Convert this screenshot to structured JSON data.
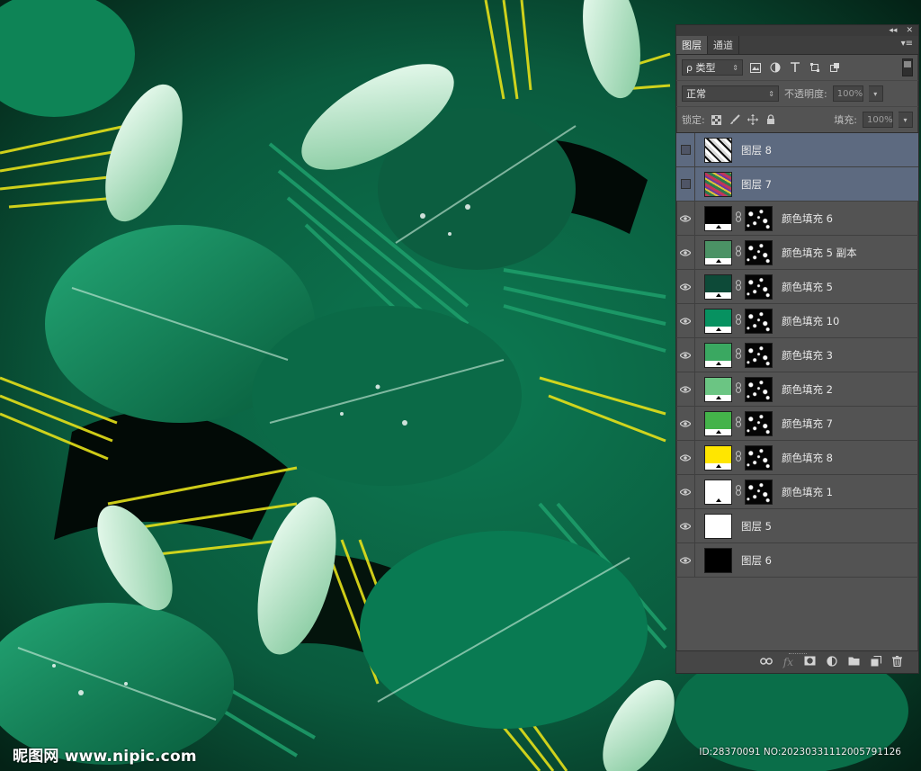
{
  "panel": {
    "tabs": [
      {
        "label": "图层"
      },
      {
        "label": "通道"
      }
    ],
    "topbar": {
      "collapse": "◂◂",
      "close": "✕"
    },
    "menu_glyph": "▾≡",
    "filter": {
      "label": "ρ 类型",
      "arrow": "⇕"
    },
    "blend": {
      "value": "正常",
      "arrow": "⇕",
      "opacity_label": "不透明度:",
      "opacity_value": "100%",
      "opacity_arrow": "▾"
    },
    "lock": {
      "label": "锁定:",
      "fill_label": "填充:",
      "fill_value": "100%",
      "fill_arrow": "▾"
    },
    "layers": [
      {
        "name": "图层 8",
        "visible": false,
        "selected": true,
        "type": "image",
        "thumb_color": "#e9e9e9"
      },
      {
        "name": "图层 7",
        "visible": false,
        "selected": true,
        "type": "image",
        "thumb_color": "#b03a55"
      },
      {
        "name": "颜色填充 6",
        "visible": true,
        "selected": false,
        "type": "fill",
        "thumb_color": "#000000"
      },
      {
        "name": "颜色填充 5 副本",
        "visible": true,
        "selected": false,
        "type": "fill",
        "thumb_color": "#4b9265"
      },
      {
        "name": "颜色填充 5",
        "visible": true,
        "selected": false,
        "type": "fill",
        "thumb_color": "#0d4a38"
      },
      {
        "name": "颜色填充 10",
        "visible": true,
        "selected": false,
        "type": "fill",
        "thumb_color": "#079160"
      },
      {
        "name": "颜色填充 3",
        "visible": true,
        "selected": false,
        "type": "fill",
        "thumb_color": "#3aa861"
      },
      {
        "name": "颜色填充 2",
        "visible": true,
        "selected": false,
        "type": "fill",
        "thumb_color": "#6bc583"
      },
      {
        "name": "颜色填充 7",
        "visible": true,
        "selected": false,
        "type": "fill",
        "thumb_color": "#44b34a"
      },
      {
        "name": "颜色填充 8",
        "visible": true,
        "selected": false,
        "type": "fill",
        "thumb_color": "#ffe600"
      },
      {
        "name": "颜色填充 1",
        "visible": true,
        "selected": false,
        "type": "fill",
        "thumb_color": "#ffffff"
      },
      {
        "name": "图层 5",
        "visible": true,
        "selected": false,
        "type": "image",
        "thumb_color": "#ffffff"
      },
      {
        "name": "图层 6",
        "visible": true,
        "selected": false,
        "type": "image",
        "thumb_color": "#000000"
      }
    ],
    "footer_icons": [
      "link-icon",
      "fx-icon",
      "mask-icon",
      "adjustment-icon",
      "group-folder-icon",
      "new-layer-icon",
      "trash-icon"
    ]
  },
  "watermark": {
    "left": "昵图网 www.nipic.com",
    "right": "ID:28370091 NO:20230331112005791126"
  }
}
